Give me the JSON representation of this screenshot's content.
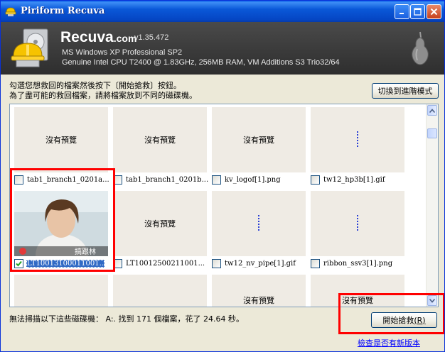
{
  "window": {
    "title": "Piriform Recuva"
  },
  "header": {
    "app_name": "Recuva",
    "app_domain": ".com",
    "version": "v1.35.472",
    "os_line": "MS Windows XP Professional SP2",
    "hw_line": "Genuine Intel CPU T2400 @ 1.83GHz, 256MB RAM, VM Additions S3 Trio32/64"
  },
  "instructions": {
    "line1": "勾選您想救回的檔案然後按下〔開始搶救〕按鈕。",
    "line2": "為了盡可能的救回檔案，請將檔案放到不同的磁碟機。"
  },
  "buttons": {
    "advanced": "切換到進階模式",
    "recover": "開始搶救",
    "recover_hotkey": "(R)"
  },
  "files": [
    {
      "name": "tab1_branch1_0201a...",
      "preview": "沒有預覽",
      "checked": false
    },
    {
      "name": "tab1_branch1_0201b...",
      "preview": "沒有預覽",
      "checked": false
    },
    {
      "name": "kv_logof[1].png",
      "preview": "沒有預覽",
      "checked": false
    },
    {
      "name": "tw12_hp3b[1].gif",
      "preview": "",
      "checked": false
    },
    {
      "name": "LT10013100011001...",
      "preview": "",
      "overlay_text": "搞跟林",
      "checked": true
    },
    {
      "name": "LT10012500211001...",
      "preview": "沒有預覽",
      "checked": false
    },
    {
      "name": "tw12_nv_pipe[1].gif",
      "preview": "",
      "checked": false
    },
    {
      "name": "ribbon_ssv3[1].png",
      "preview": "",
      "checked": false
    },
    {
      "name": "",
      "preview": "",
      "checked": false
    },
    {
      "name": "",
      "preview": "",
      "checked": false
    },
    {
      "name": "",
      "preview": "沒有預覽",
      "checked": false
    },
    {
      "name": "",
      "preview": "沒有預覽",
      "checked": false
    }
  ],
  "status": "無法掃描以下這些磁碟機： A:. 找到 171 個檔案，花了 24.64 秒。",
  "update_link": "檢查是否有新版本",
  "colors": {
    "highlight": "#ff0000",
    "selection": "#316ac5",
    "titlebar": "#0a5fe8"
  },
  "icons": [
    "recuva-app-icon",
    "minimize-icon",
    "maximize-icon",
    "close-icon",
    "recuva-logo-icon",
    "piriform-pear-icon",
    "scroll-up-icon",
    "scroll-down-icon",
    "checkbox-icon"
  ]
}
